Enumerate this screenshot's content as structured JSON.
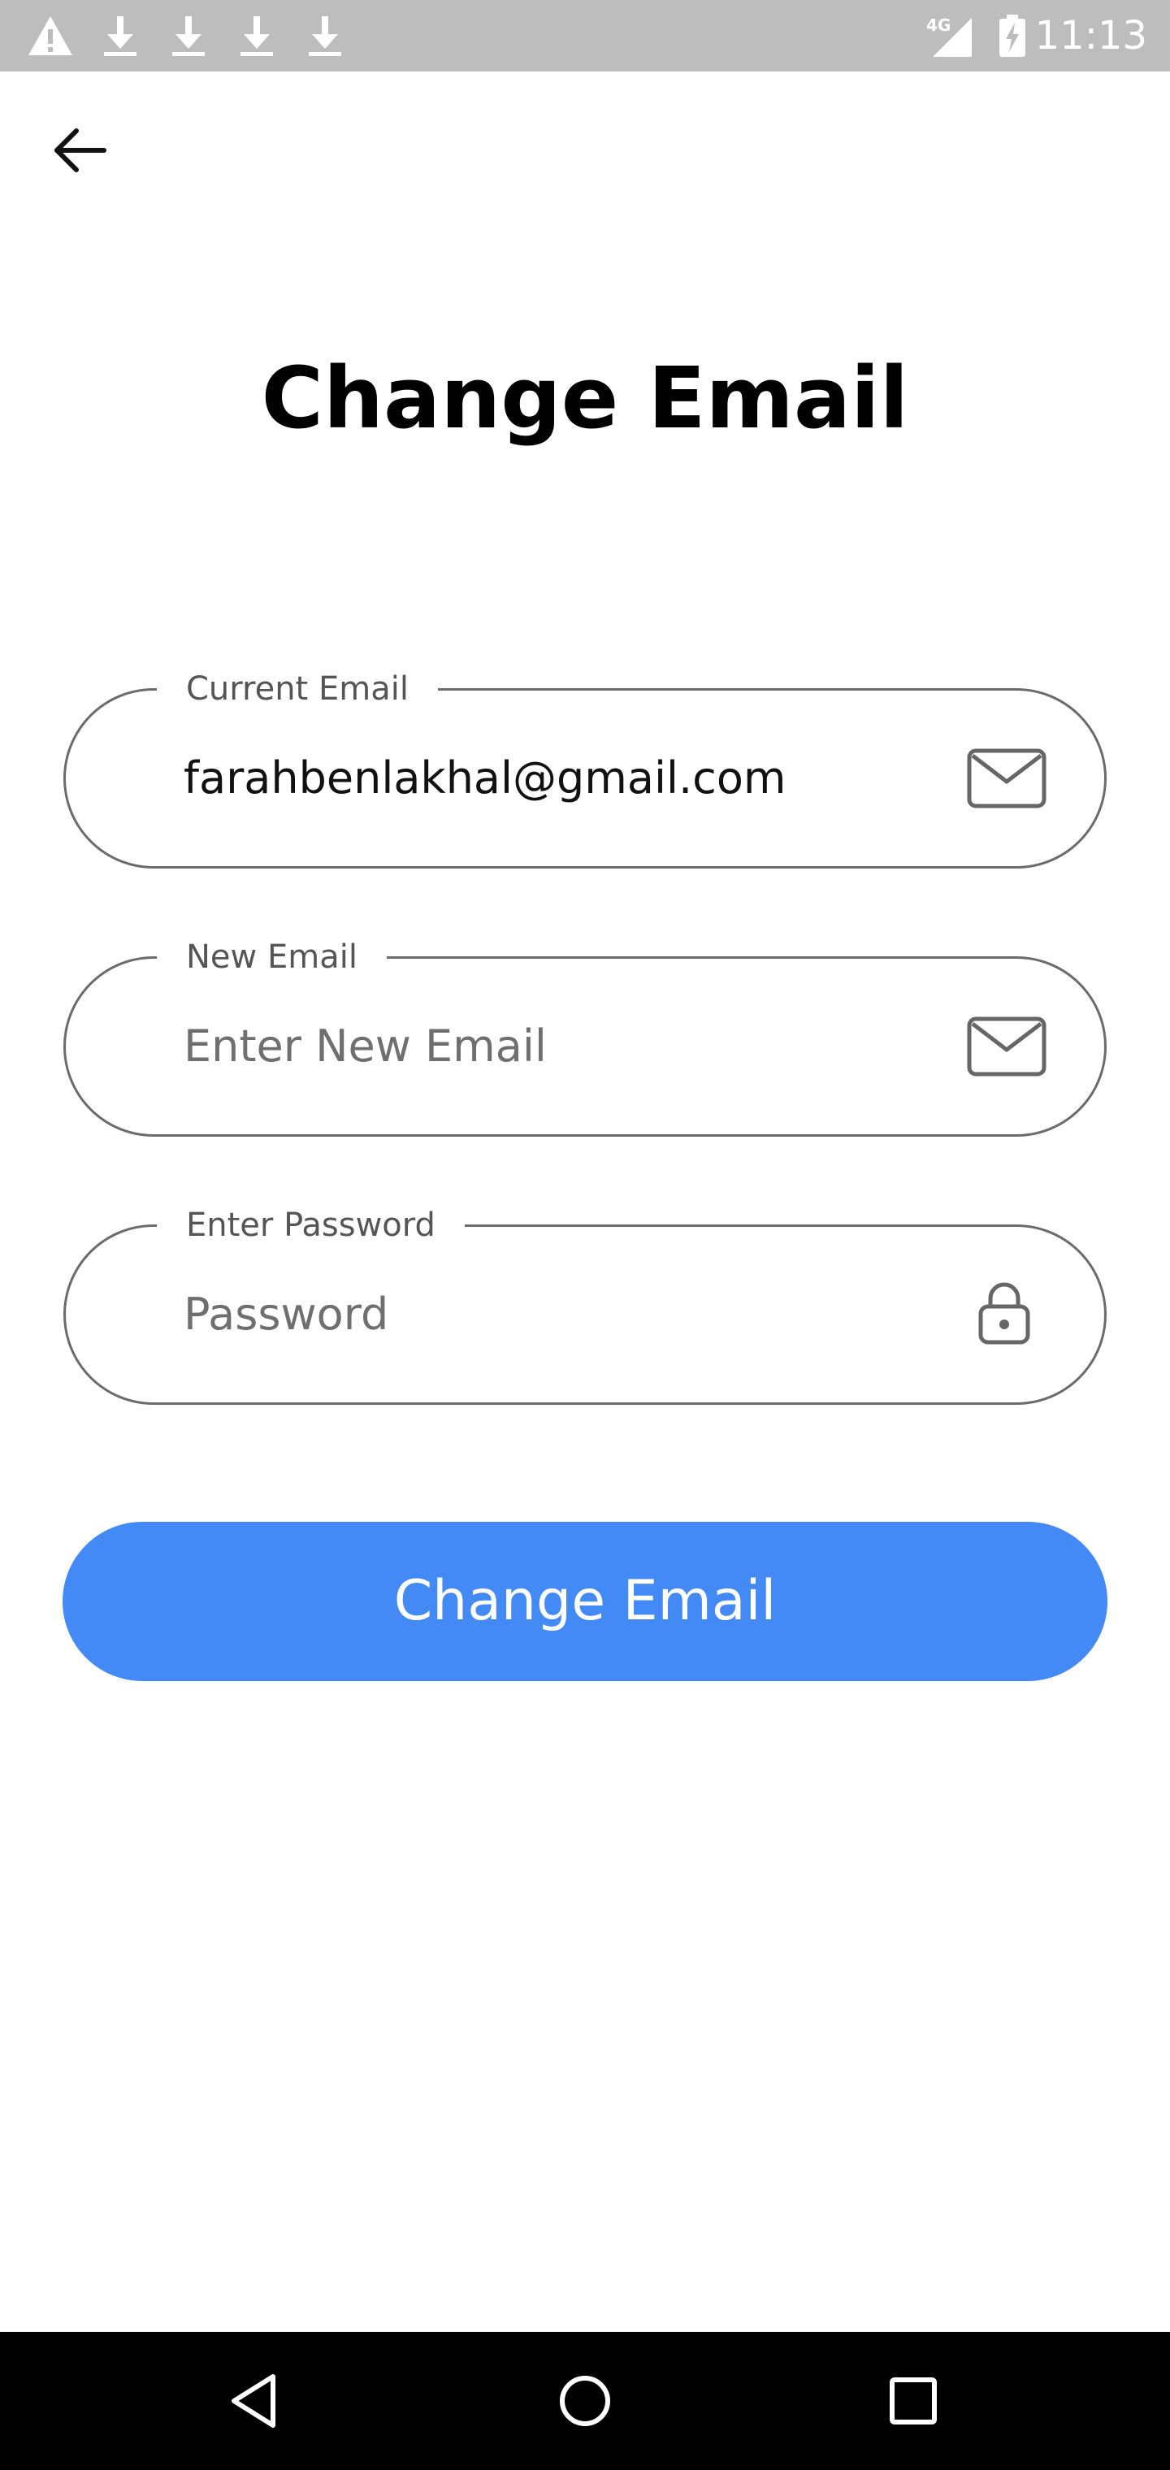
{
  "status_bar": {
    "time": "11:13",
    "network": "4G",
    "icons": [
      "warning-icon",
      "download-icon",
      "download-icon",
      "download-icon",
      "download-icon",
      "signal-icon",
      "battery-charging-icon"
    ]
  },
  "header": {
    "back_icon": "arrow-left-icon",
    "title": "Change Email"
  },
  "form": {
    "current_email": {
      "label": "Current Email",
      "value": "farahbenlakhal@gmail.com",
      "icon": "mail-icon"
    },
    "new_email": {
      "label": "New Email",
      "value": "",
      "placeholder": "Enter New Email",
      "icon": "mail-icon"
    },
    "password": {
      "label": "Enter Password",
      "value": "",
      "placeholder": "Password",
      "icon": "lock-icon"
    },
    "submit_label": "Change Email"
  },
  "nav_bar": {
    "buttons": [
      "back-triangle-icon",
      "home-circle-icon",
      "recents-square-icon"
    ]
  },
  "colors": {
    "accent": "#448af7",
    "status_bar_bg": "#bdbdbd",
    "field_border": "#6b6b6b",
    "nav_bar_bg": "#000000"
  }
}
